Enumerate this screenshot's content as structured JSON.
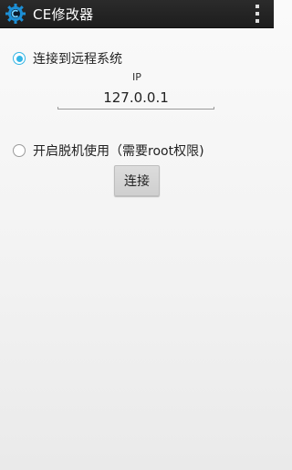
{
  "action_bar": {
    "title": "CE修改器",
    "app_icon": "ce-gear-logo-icon",
    "overflow_icon": "overflow-menu-icon"
  },
  "remote": {
    "label": "连接到远程系统",
    "checked": true,
    "ip_label": "IP",
    "ip_value": "127.0.0.1"
  },
  "offline": {
    "label": "开启脱机使用（需要root权限)",
    "checked": false
  },
  "connect_button": {
    "label": "连接"
  },
  "colors": {
    "accent": "#33b5e5",
    "action_bar": "#222222"
  }
}
